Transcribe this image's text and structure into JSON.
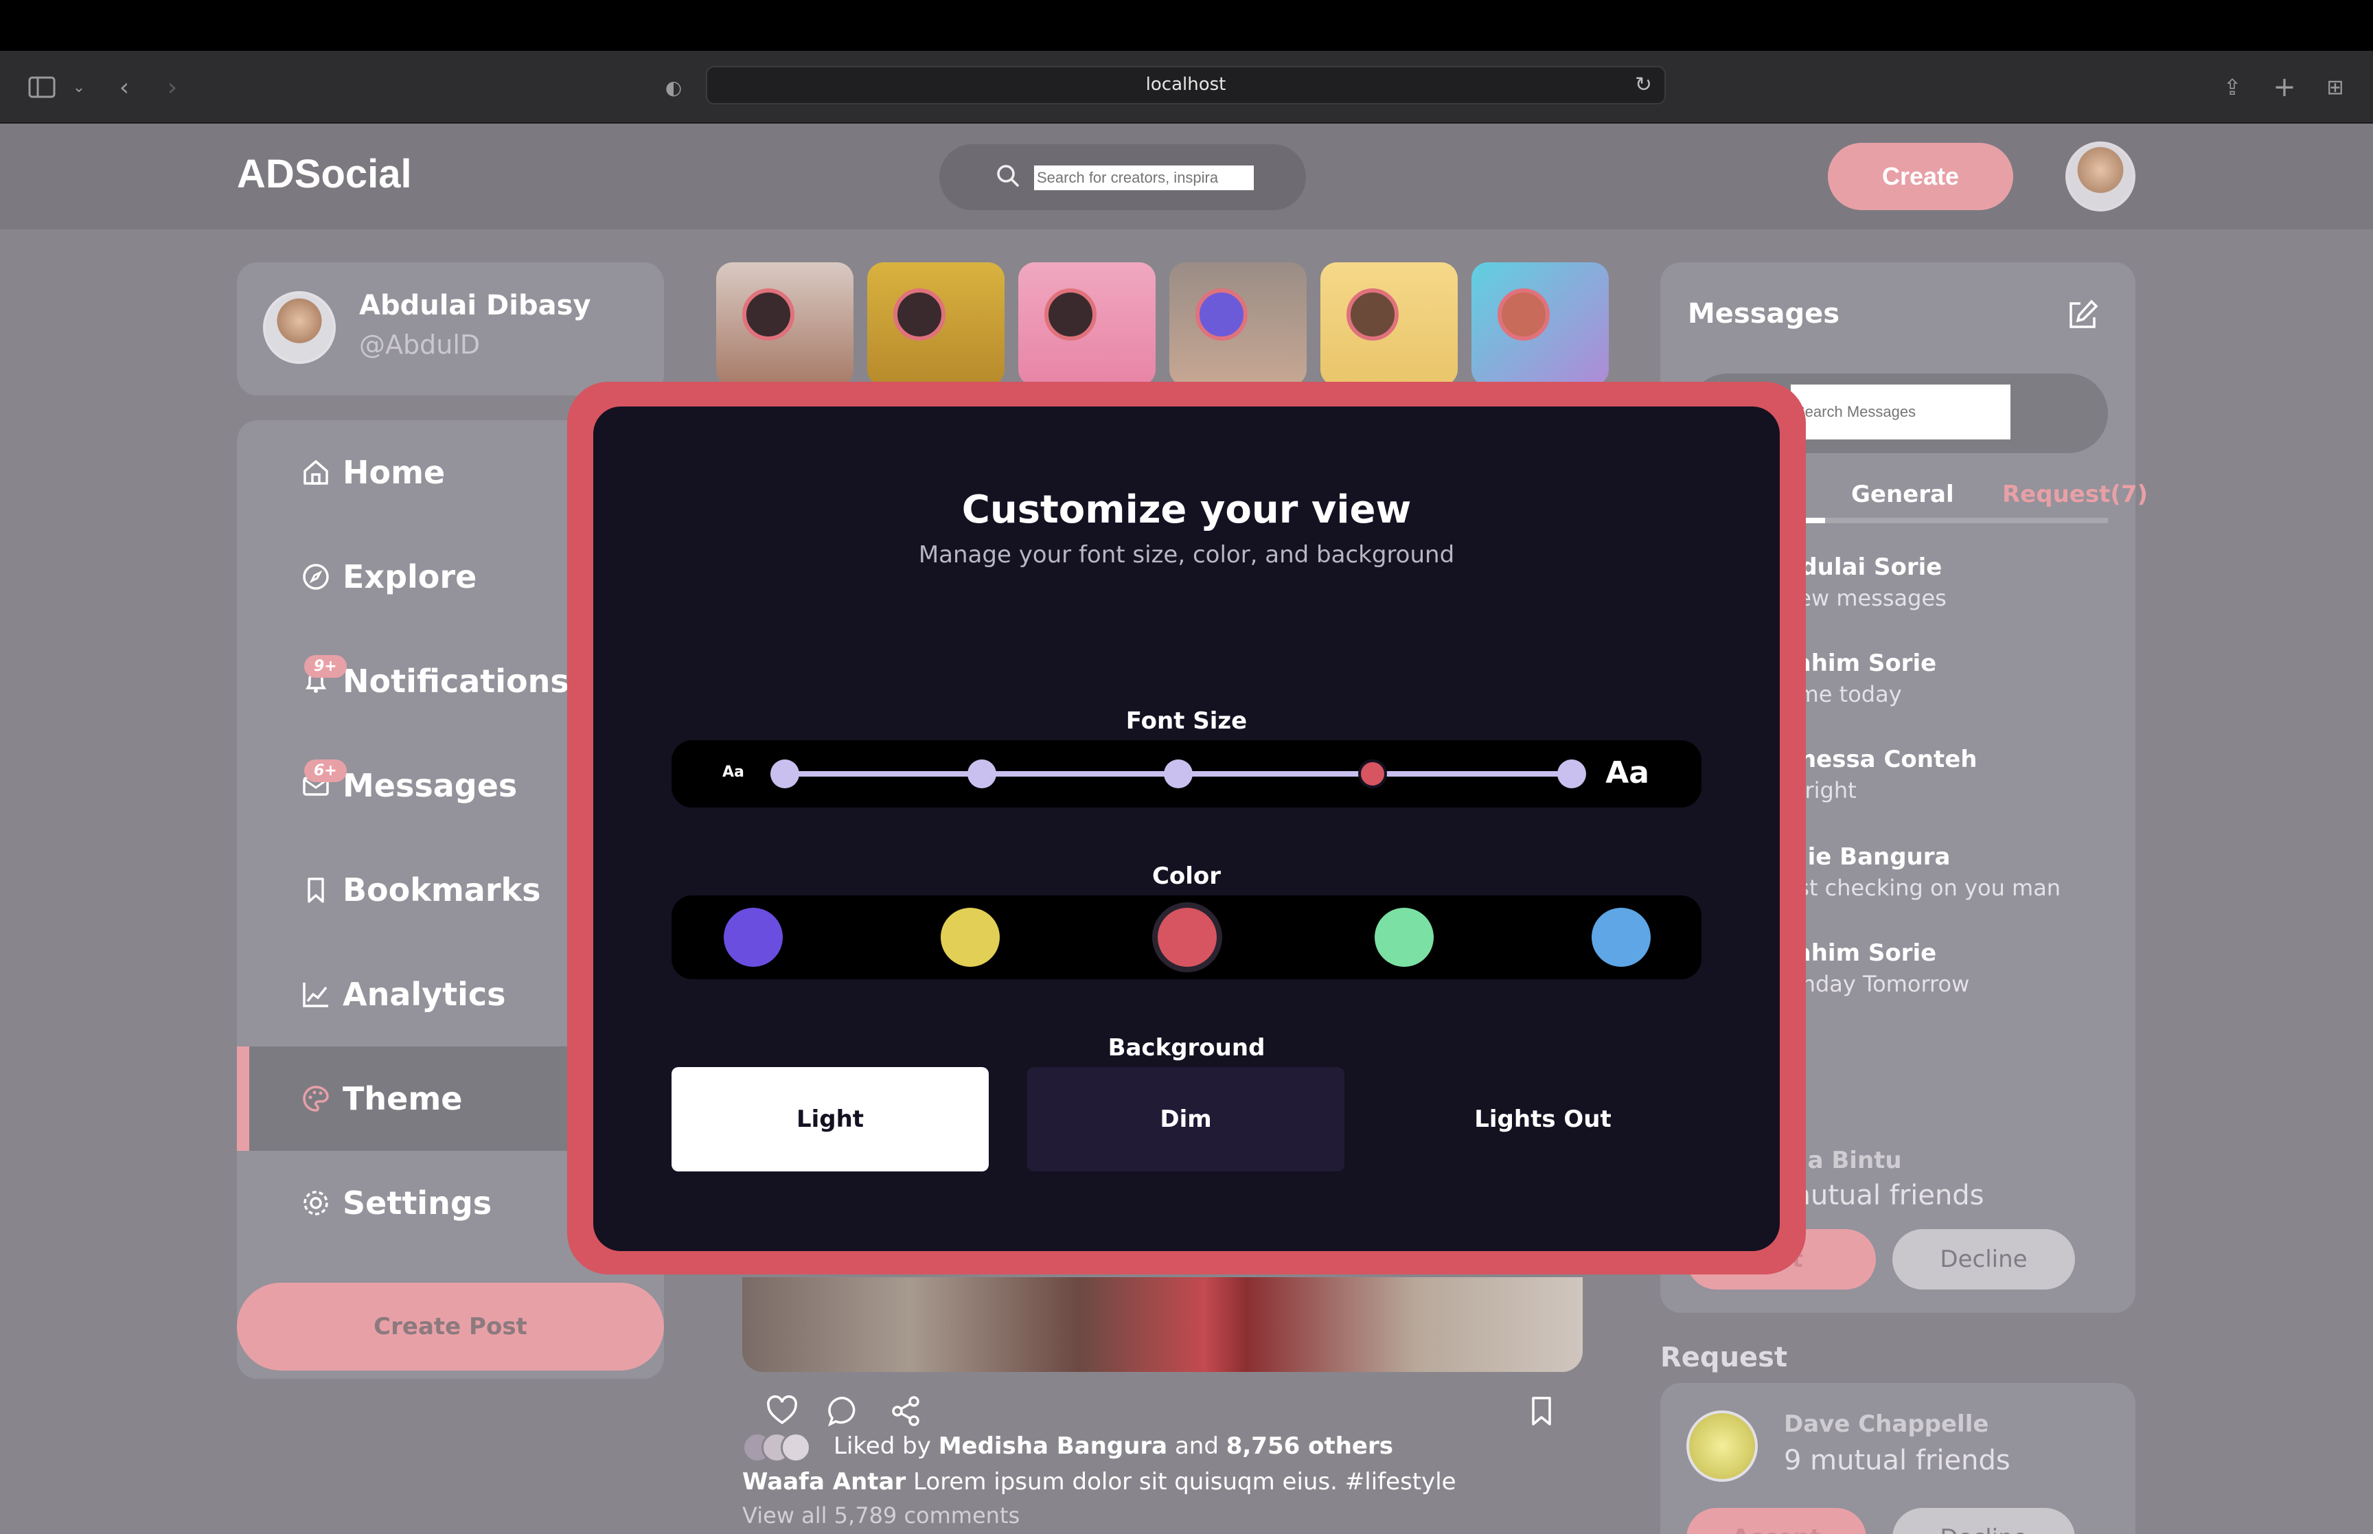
{
  "browser": {
    "url": "localhost"
  },
  "app": {
    "logo": "ADSocial",
    "search_placeholder": "Search for creators, inspira",
    "create_label": "Create"
  },
  "profile": {
    "name": "Abdulai Dibasy",
    "handle": "@AbdulD"
  },
  "nav": {
    "items": [
      {
        "label": "Home",
        "icon": "home-icon"
      },
      {
        "label": "Explore",
        "icon": "compass-icon"
      },
      {
        "label": "Notifications",
        "icon": "bell-icon",
        "badge": "9+"
      },
      {
        "label": "Messages",
        "icon": "envelope-icon",
        "badge": "6+"
      },
      {
        "label": "Bookmarks",
        "icon": "bookmark-icon"
      },
      {
        "label": "Analytics",
        "icon": "chart-icon"
      },
      {
        "label": "Theme",
        "icon": "palette-icon",
        "active": true
      },
      {
        "label": "Settings",
        "icon": "gear-icon"
      }
    ],
    "create_post_label": "Create Post"
  },
  "feed": {
    "liked_prefix": "Liked by",
    "liked_by": "Medisha Bangura",
    "liked_and": "and",
    "liked_others": "8,756 others",
    "caption_author": "Waafa Antar",
    "caption_text": "Lorem ipsum dolor sit quisuqm eius. #lifestyle",
    "view_comments": "View all 5,789 comments"
  },
  "messages": {
    "title": "Messages",
    "search_placeholder": "Search Messages",
    "tabs": [
      {
        "label": "General",
        "active": false
      },
      {
        "label": "Request(7)",
        "active": false
      }
    ],
    "list": [
      {
        "name": "bdulai Sorie",
        "preview": "new messages"
      },
      {
        "name": "rahim Sorie",
        "preview": "ame today"
      },
      {
        "name": "anessa Conteh",
        "preview": "u right"
      },
      {
        "name": "alie Bangura",
        "preview": "ust checking on you man"
      },
      {
        "name": "rahim Sorie",
        "preview": "rthday Tomorrow"
      }
    ]
  },
  "friend_requests": [
    {
      "name": "aja Bintu",
      "mutual": "mutual friends",
      "accept": "ept",
      "decline": "Decline"
    },
    {
      "name": "Dave Chappelle",
      "mutual": "9 mutual friends",
      "accept": "Accept",
      "decline": "Decline"
    }
  ],
  "request_heading": "Request",
  "modal": {
    "title": "Customize your view",
    "subtitle": "Manage your font size, color, and background",
    "font_size_label": "Font Size",
    "font_small": "Aa",
    "font_large": "Aa",
    "font_size_steps": 5,
    "font_size_selected_index": 3,
    "color_label": "Color",
    "colors": [
      "#6a4ee0",
      "#e2cf55",
      "#d65560",
      "#7be0a3",
      "#5ea6e6"
    ],
    "color_selected_index": 2,
    "background_label": "Background",
    "backgrounds": [
      {
        "label": "Light",
        "bg": "#ffffff",
        "fg": "#141121"
      },
      {
        "label": "Dim",
        "bg": "#221b36",
        "fg": "#ffffff"
      },
      {
        "label": "Lights Out",
        "bg": "#141121",
        "fg": "#ffffff"
      }
    ],
    "accent": "#d65560"
  }
}
